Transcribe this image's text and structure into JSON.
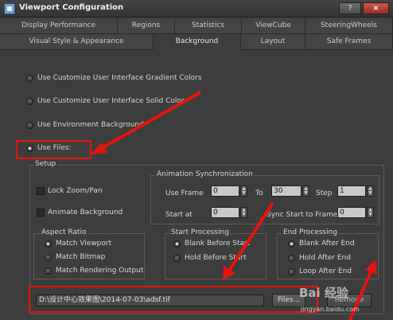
{
  "window": {
    "title": "Viewport Configuration",
    "help_label": "?",
    "close_label": "×"
  },
  "tabs_row1": [
    "Display Performance",
    "Regions",
    "Statistics",
    "ViewCube",
    "SteeringWheels"
  ],
  "tabs_row2": [
    "Visual Style & Appearance",
    "Background",
    "Layout",
    "Safe Frames"
  ],
  "active_tab": "Background",
  "background_options": [
    {
      "label": "Use Customize User Interface Gradient Colors",
      "selected": false
    },
    {
      "label": "Use Customize User Interface Solid Color",
      "selected": false
    },
    {
      "label": "Use Environment Background",
      "selected": false
    },
    {
      "label": "Use Files:",
      "selected": true
    }
  ],
  "setup": {
    "label": "Setup",
    "lock_zoom_pan": {
      "label": "Lock Zoom/Pan",
      "checked": false
    },
    "animate_background": {
      "label": "Animate Background",
      "checked": false
    },
    "aspect_ratio": {
      "label": "Aspect Ratio",
      "options": [
        {
          "label": "Match Viewport",
          "selected": true
        },
        {
          "label": "Match Bitmap",
          "selected": false
        },
        {
          "label": "Match Rendering Output",
          "selected": false
        }
      ]
    },
    "anim_sync": {
      "label": "Animation Synchronization",
      "use_frame_label": "Use Frame",
      "use_frame_value": "0",
      "to_label": "To",
      "to_value": "30",
      "step_label": "Step",
      "step_value": "1",
      "start_at_label": "Start at",
      "start_at_value": "0",
      "sync_start_label": "Sync Start to Frame",
      "sync_start_value": "0"
    },
    "start_processing": {
      "label": "Start Processing",
      "options": [
        {
          "label": "Blank Before Start",
          "selected": true
        },
        {
          "label": "Hold Before Start",
          "selected": false
        }
      ]
    },
    "end_processing": {
      "label": "End Processing",
      "options": [
        {
          "label": "Blank After End",
          "selected": true
        },
        {
          "label": "Hold After End",
          "selected": false
        },
        {
          "label": "Loop After End",
          "selected": false
        }
      ]
    },
    "file_path": "D:\\设计中心效果图\\2014-07-03\\adsf.tif",
    "files_button": "Files...",
    "remove_button": "Remove"
  },
  "watermark": {
    "text": "Bai 经验",
    "sub": "jingyan.baidu.com"
  },
  "colors": {
    "dialog_bg": "#3d3d3d",
    "annotation_red": "#e3150d",
    "field_bg": "#c8c8c8"
  }
}
